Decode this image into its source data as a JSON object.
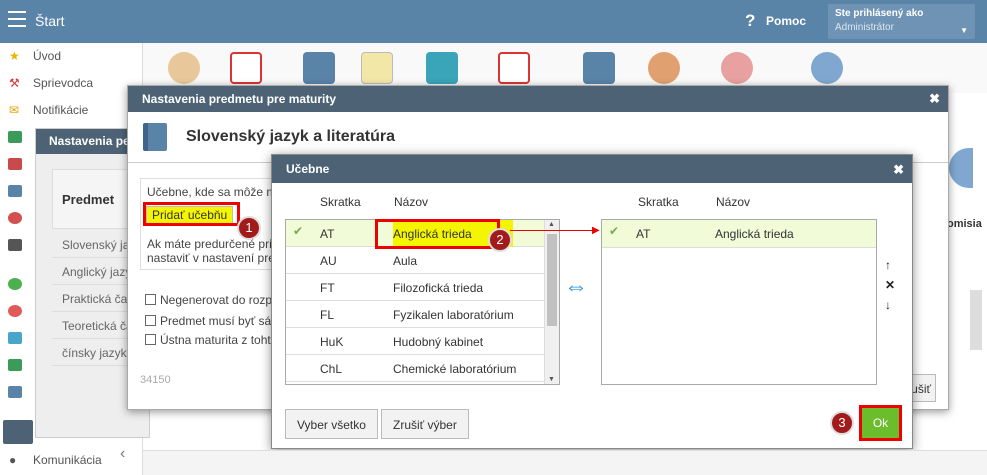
{
  "topbar": {
    "title": "Štart",
    "help": "Pomoc",
    "user_label": "Ste prihlásený ako",
    "user_name": "Administrátor"
  },
  "sidebar": {
    "items": [
      "Úvod",
      "Sprievodca",
      "Notifikácie"
    ],
    "bottom_item": "Komunikácia"
  },
  "bgpanel": {
    "title": "Nastavenia pe",
    "header": "Predmet",
    "rows": [
      "Slovenský ja",
      "Anglický jazy",
      "Praktická čas",
      "Teoretická ča",
      "čínsky jazyk"
    ]
  },
  "dialog1": {
    "header": "Nastavenia predmetu pre maturity",
    "title": "Slovenský jazyk a literatúra",
    "text1": "Učebne, kde sa môže m",
    "add_button": "Pridať učebňu",
    "text2a": "Ak máte predurčené pri",
    "text2b": "nastaviť v nastavení pre",
    "check1": "Negenerovat do rozp",
    "check2": "Predmet musí byť sá",
    "check3": "Ústna maturita z toht",
    "code": "34150",
    "cut_right1": "omisia",
    "cut_right2": "ušiť"
  },
  "dialog2": {
    "header": "Učebne",
    "col_short": "Skratka",
    "col_name": "Názov",
    "rows": [
      {
        "short": "AT",
        "name": "Anglická trieda"
      },
      {
        "short": "AU",
        "name": "Aula"
      },
      {
        "short": "FT",
        "name": "Filozofická trieda"
      },
      {
        "short": "FL",
        "name": "Fyzikalen laboratórium"
      },
      {
        "short": "HuK",
        "name": "Hudobný kabinet"
      },
      {
        "short": "ChL",
        "name": "Chemické laboratórium"
      }
    ],
    "selected": [
      {
        "short": "AT",
        "name": "Anglická trieda"
      }
    ],
    "select_all": "Vyber všetko",
    "deselect": "Zrušiť výber",
    "ok": "Ok"
  },
  "arrows": {
    "up": "↑",
    "remove": "✕",
    "down": "↓",
    "swap": "⇔"
  },
  "badges": [
    "1",
    "2",
    "3"
  ],
  "colors": {
    "header": "#4d6375",
    "topbar": "#5a83a8",
    "highlight": "#f5f500",
    "ok": "#6cbd2c",
    "marker": "#e00000"
  }
}
